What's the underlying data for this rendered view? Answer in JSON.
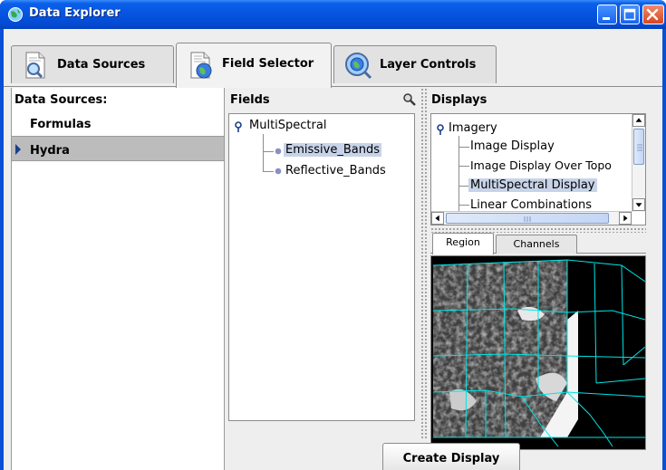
{
  "window": {
    "title": "Data Explorer",
    "controls": [
      "minimize",
      "maximize",
      "close"
    ]
  },
  "tabs": [
    {
      "label": "Data Sources",
      "icon": "document-magnifier-icon",
      "active": false
    },
    {
      "label": "Field Selector",
      "icon": "document-globe-icon",
      "active": true
    },
    {
      "label": "Layer Controls",
      "icon": "globe-magnifier-icon",
      "active": false
    }
  ],
  "data_sources": {
    "header": "Data Sources:",
    "items": [
      {
        "label": "Formulas",
        "selected": false
      },
      {
        "label": "Hydra",
        "selected": true
      }
    ]
  },
  "fields": {
    "header": "Fields",
    "root": "MultiSpectral",
    "children": [
      {
        "label": "Emissive_Bands",
        "selected": true
      },
      {
        "label": "Reflective_Bands",
        "selected": false
      }
    ]
  },
  "displays": {
    "header": "Displays",
    "root": "Imagery",
    "children": [
      {
        "label": "Image Display",
        "selected": false
      },
      {
        "label": "Image Display Over Topo",
        "selected": false
      },
      {
        "label": "MultiSpectral Display",
        "selected": true
      },
      {
        "label": "Linear Combinations",
        "selected": false
      }
    ],
    "subtabs": [
      {
        "label": "Region",
        "active": true
      },
      {
        "label": "Channels",
        "active": false
      }
    ]
  },
  "actions": {
    "create_display": "Create Display"
  },
  "colors": {
    "title_bar": "#0554e0",
    "selection": "#c7d3e8",
    "list_selection": "#bcbcbc",
    "map_lines": "#00e5e5"
  }
}
